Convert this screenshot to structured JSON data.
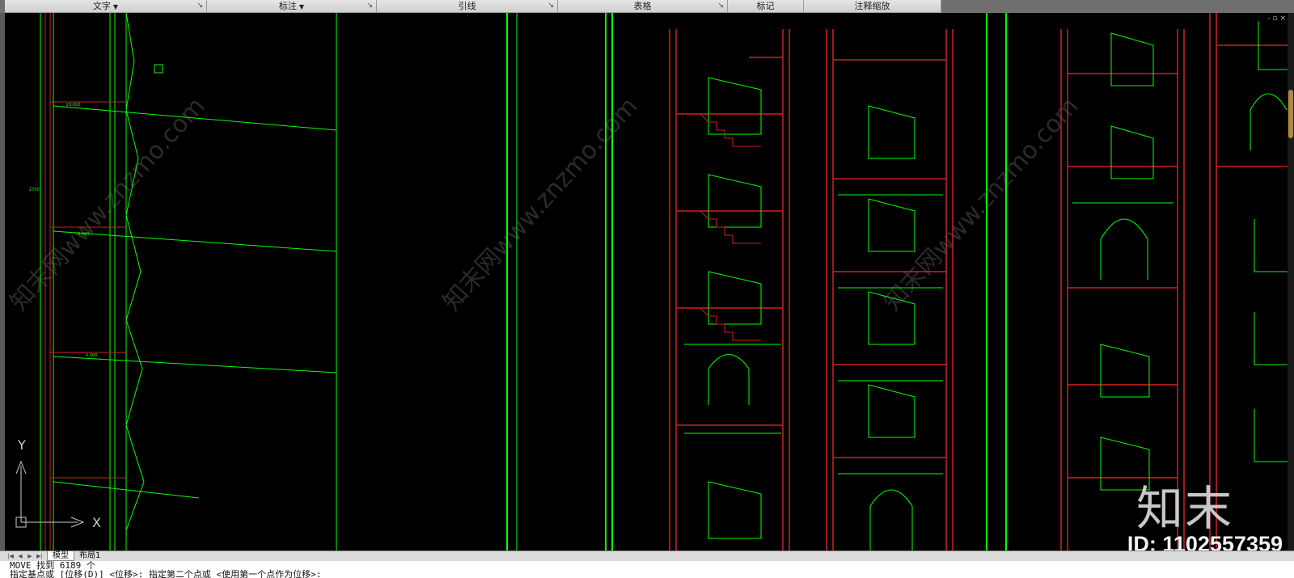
{
  "ribbon": {
    "panels": [
      {
        "label": "文字",
        "has_dropdown": true
      },
      {
        "label": "标注",
        "has_dropdown": true
      },
      {
        "label": "引线",
        "has_dropdown": false
      },
      {
        "label": "表格",
        "has_dropdown": false
      },
      {
        "label": "标记",
        "has_dropdown": false
      },
      {
        "label": "注释缩放",
        "has_dropdown": false
      }
    ]
  },
  "window_controls": "- ▫ ×",
  "ucs": {
    "y_label": "Y",
    "x_label": "X"
  },
  "tabs": {
    "model": "模型",
    "layout1": "布局1"
  },
  "command": {
    "line1": "MOVE 找到 6189 个",
    "line2": "指定基点或 [位移(D)] <位移>:  指定第二个点或 <使用第一个点作为位移>:"
  },
  "watermark": {
    "logo_text": "知末",
    "id_text": "ID: 1102557359",
    "diagonal_text": "知末网www.znzmo.com"
  },
  "colors": {
    "background": "#000000",
    "green": "#00ff00",
    "red": "#cc2222",
    "white": "#ffffff"
  }
}
